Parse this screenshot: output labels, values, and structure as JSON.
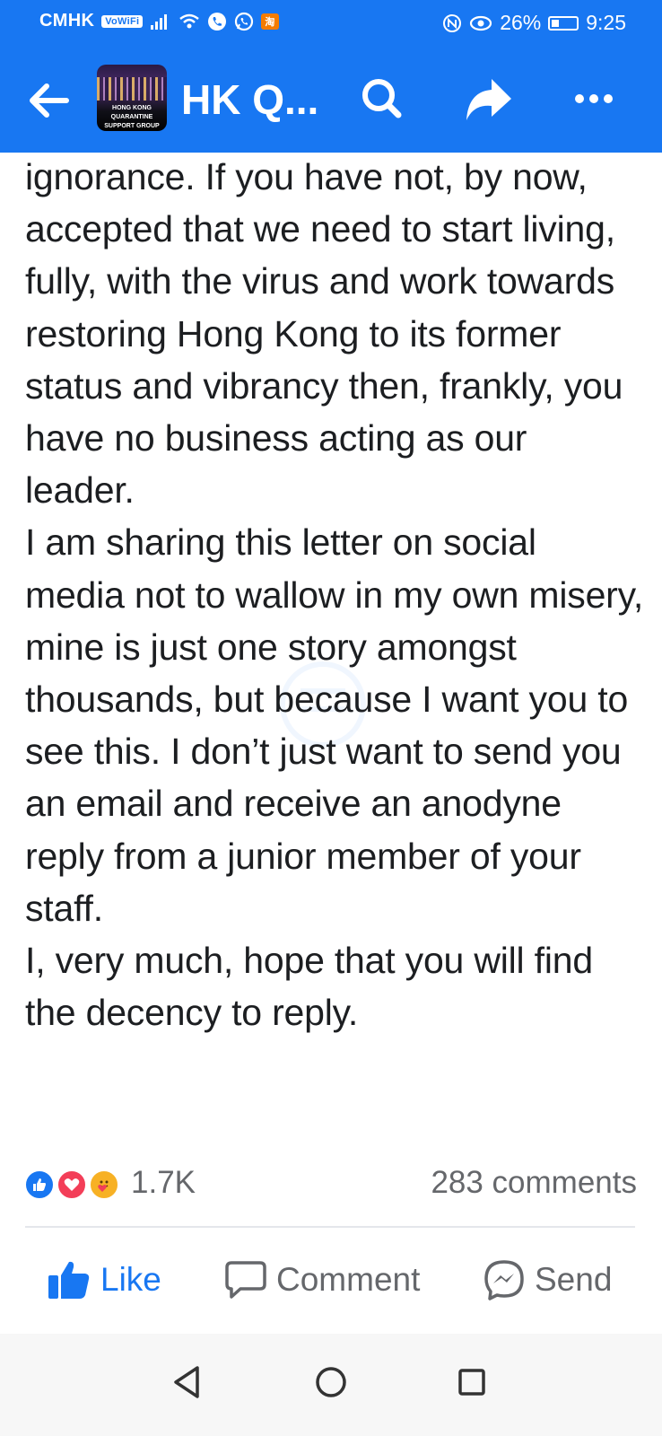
{
  "status_bar": {
    "carrier": "CMHK",
    "vowifi": "VoWiFi",
    "taobao": "淘",
    "battery": "26%",
    "time": "9:25",
    "battery_level": 0.26
  },
  "header": {
    "group_thumb_text": "HONG KONG QUARANTINE SUPPORT GROUP",
    "title": "HK Q..."
  },
  "post": {
    "paragraphs": [
      "ignorance. If you have not, by now, accepted that we need to start living, fully, with the virus and work towards restoring Hong Kong to its former status and vibrancy then, frankly, you have no business acting as our leader.",
      "I am sharing this letter on social media not to wallow in my own misery, mine is just one story amongst thousands, but because I want you to see this. I don’t just want to send you an email and receive an anodyne reply from a junior member of your staff.",
      "I, very much, hope that you will find the decency to reply."
    ]
  },
  "reactions": {
    "count": "1.7K",
    "comments": "283 comments"
  },
  "actions": {
    "like": "Like",
    "comment": "Comment",
    "send": "Send"
  },
  "colors": {
    "brand": "#1877f2",
    "text": "#1c1e21",
    "muted": "#65676b"
  },
  "icons": [
    "back-arrow-icon",
    "search-icon",
    "share-icon",
    "more-icon",
    "like-reaction-icon",
    "love-reaction-icon",
    "care-reaction-icon",
    "thumbs-up-icon",
    "comment-icon",
    "messenger-icon",
    "nav-back-icon",
    "nav-home-icon",
    "nav-recent-icon"
  ]
}
